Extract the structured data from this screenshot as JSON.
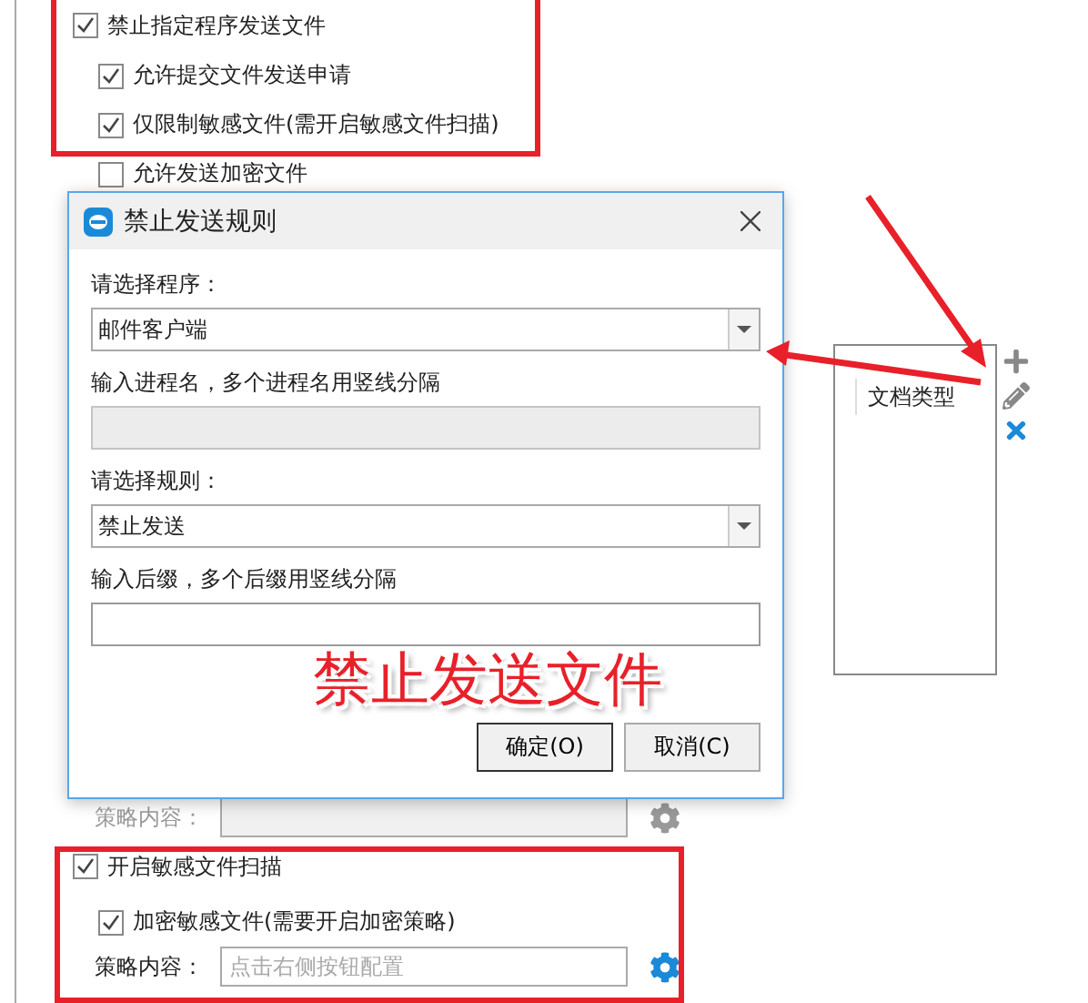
{
  "options": [
    {
      "label": "禁止指定程序发送文件",
      "checked": true,
      "children": [
        {
          "label": "允许提交文件发送申请",
          "checked": true
        },
        {
          "label": "仅限制敏感文件(需开启敏感文件扫描)",
          "checked": true
        },
        {
          "label": "允许发送加密文件",
          "checked": false
        }
      ]
    }
  ],
  "rule_table": {
    "columns": [
      "文档类型"
    ]
  },
  "policy_top": {
    "label": "策略内容：",
    "disabled": true
  },
  "scan": {
    "label": "开启敏感文件扫描",
    "checked": true,
    "children": [
      {
        "label": "加密敏感文件(需要开启加密策略)",
        "checked": true
      }
    ],
    "policy": {
      "label": "策略内容：",
      "placeholder": "点击右侧按钮配置",
      "disabled": false
    }
  },
  "dialog": {
    "title": "禁止发送规则",
    "fields": [
      {
        "kind": "select",
        "label": "请选择程序：",
        "value": "邮件客户端"
      },
      {
        "kind": "input",
        "label": "输入进程名，多个进程名用竖线分隔",
        "disabled": true
      },
      {
        "kind": "select",
        "label": "请选择规则：",
        "value": "禁止发送"
      },
      {
        "kind": "input",
        "label": "输入后缀，多个后缀用竖线分隔",
        "disabled": false
      }
    ],
    "buttons": [
      {
        "label": "确定(O)",
        "default": true
      },
      {
        "label": "取消(C)",
        "default": false
      }
    ]
  },
  "annotation": {
    "text": "禁止发送文件"
  }
}
